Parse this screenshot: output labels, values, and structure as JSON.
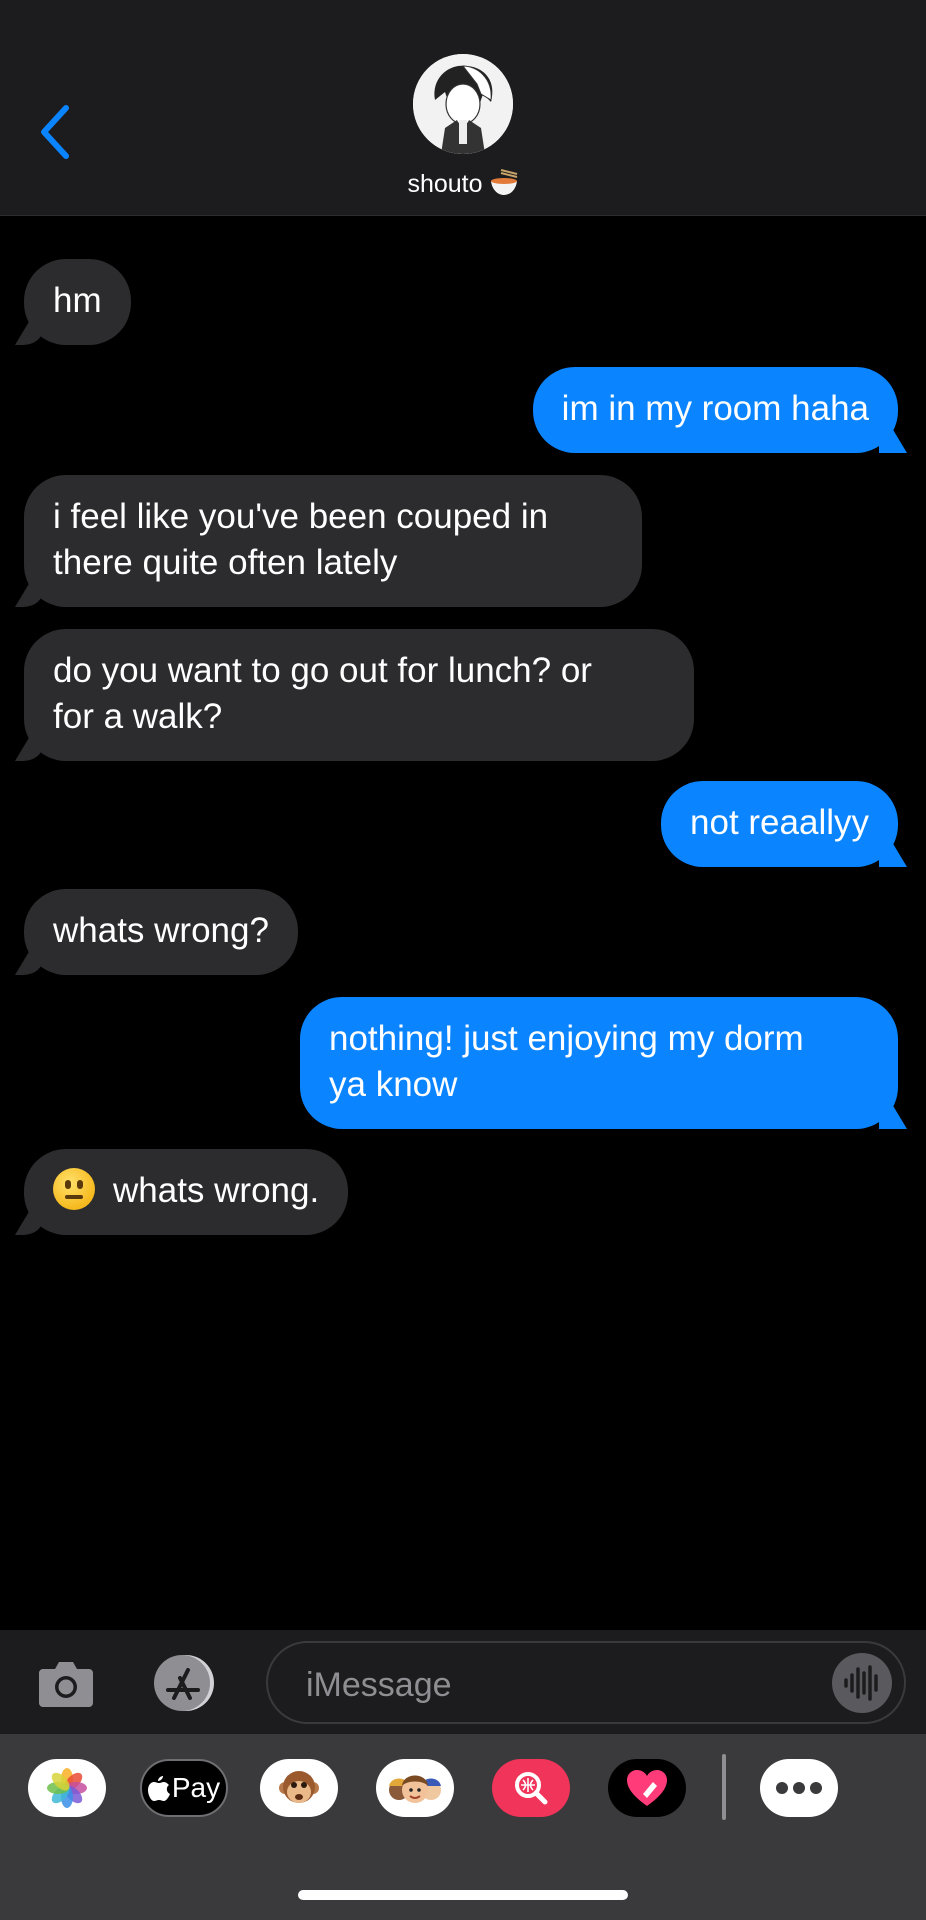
{
  "header": {
    "contact_name": "shouto",
    "contact_emoji_icon": "noodle-bowl-icon",
    "back_icon": "chevron-left-icon",
    "accent": "#0a84ff"
  },
  "messages": [
    {
      "from": "them",
      "text": "hm"
    },
    {
      "from": "me",
      "text": "im in my room haha"
    },
    {
      "from": "them",
      "text": "i feel like you've been couped in\nthere quite often lately"
    },
    {
      "from": "them",
      "text": "do you want to go out for lunch? or\nfor a walk?"
    },
    {
      "from": "me",
      "text": "not reaallyy"
    },
    {
      "from": "them",
      "text": "whats wrong?"
    },
    {
      "from": "me",
      "text": "nothing! just enjoying my dorm\nya know"
    },
    {
      "from": "them",
      "text": "whats wrong.",
      "emoji": "neutral-face-icon"
    }
  ],
  "input": {
    "placeholder": "iMessage"
  },
  "drawer": {
    "apple_pay_label": "Pay",
    "apps": [
      "photos-icon",
      "apple-pay-icon",
      "animoji-monkey-icon",
      "memoji-icon",
      "search-images-icon",
      "digital-touch-icon",
      "more-apps-icon"
    ]
  },
  "colors": {
    "sent_bubble": "#0a84ff",
    "received_bubble": "#2c2c2e",
    "background": "#000000"
  }
}
